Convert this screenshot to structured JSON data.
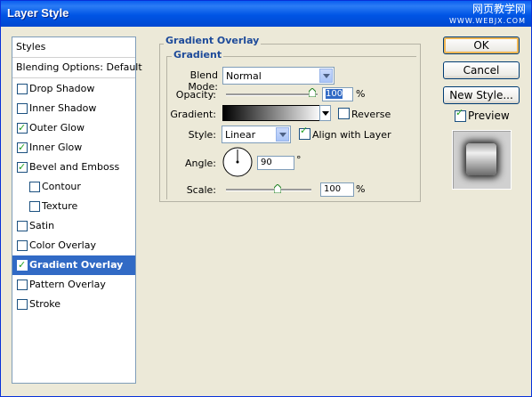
{
  "window": {
    "title": "Layer Style"
  },
  "watermark": {
    "line1": "网页教学网",
    "line2": "WWW.WEBJX.COM"
  },
  "styles_panel": {
    "header": "Styles",
    "blending": "Blending Options: Default",
    "items": [
      {
        "label": "Drop Shadow",
        "checked": false
      },
      {
        "label": "Inner Shadow",
        "checked": false
      },
      {
        "label": "Outer Glow",
        "checked": true
      },
      {
        "label": "Inner Glow",
        "checked": true
      },
      {
        "label": "Bevel and Emboss",
        "checked": true
      },
      {
        "label": "Contour",
        "checked": false
      },
      {
        "label": "Texture",
        "checked": false
      },
      {
        "label": "Satin",
        "checked": false
      },
      {
        "label": "Color Overlay",
        "checked": false
      },
      {
        "label": "Gradient Overlay",
        "checked": true,
        "selected": true
      },
      {
        "label": "Pattern Overlay",
        "checked": false
      },
      {
        "label": "Stroke",
        "checked": false
      }
    ]
  },
  "gradient_overlay": {
    "group_title": "Gradient Overlay",
    "sub_title": "Gradient",
    "blend_mode": {
      "label": "Blend Mode:",
      "value": "Normal"
    },
    "opacity": {
      "label": "Opacity:",
      "value": "100",
      "unit": "%",
      "level": 1.0
    },
    "gradient": {
      "label": "Gradient:",
      "reverse_label": "Reverse",
      "reverse_checked": false
    },
    "style": {
      "label": "Style:",
      "value": "Linear"
    },
    "align": {
      "label": "Align with Layer",
      "checked": true
    },
    "angle": {
      "label": "Angle:",
      "value": "90",
      "unit": "°"
    },
    "scale": {
      "label": "Scale:",
      "value": "100",
      "unit": "%",
      "level": 0.6
    }
  },
  "buttons": {
    "ok": "OK",
    "cancel": "Cancel",
    "new_style": "New Style..."
  },
  "preview": {
    "label": "Preview",
    "checked": true
  },
  "colors": {
    "title_bar": "#0055e5",
    "selection": "#316ac5",
    "group_title": "#1e4b9a"
  }
}
